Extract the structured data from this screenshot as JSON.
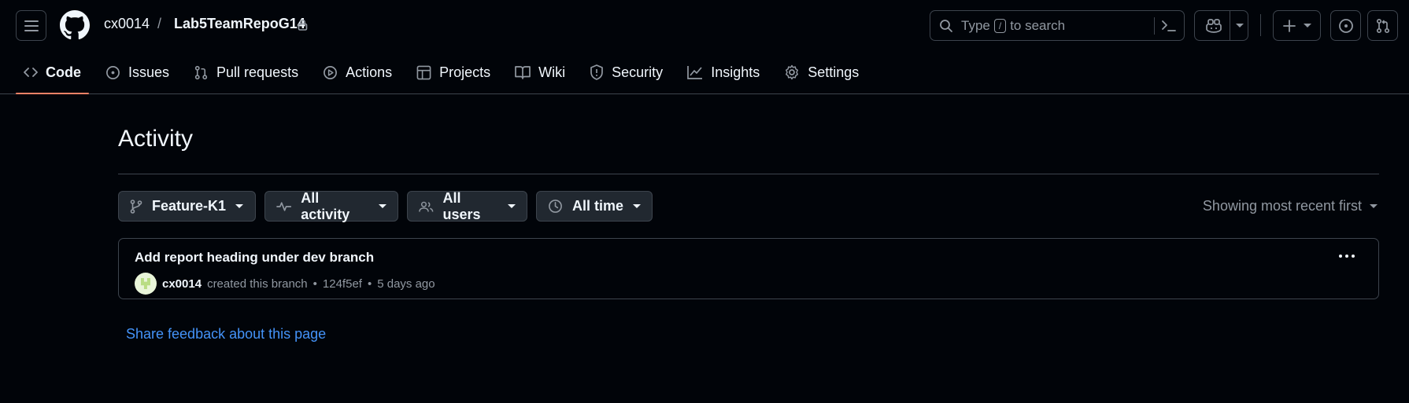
{
  "header": {
    "owner": "cx0014",
    "separator": "/",
    "repo": "Lab5TeamRepoG14",
    "search_prefix": "Type",
    "search_key": "/",
    "search_suffix": "to search"
  },
  "tabs": [
    {
      "label": "Code",
      "icon": "code-icon",
      "active": true
    },
    {
      "label": "Issues",
      "icon": "issue-opened-icon"
    },
    {
      "label": "Pull requests",
      "icon": "git-pull-request-icon"
    },
    {
      "label": "Actions",
      "icon": "play-icon"
    },
    {
      "label": "Projects",
      "icon": "table-icon"
    },
    {
      "label": "Wiki",
      "icon": "book-icon"
    },
    {
      "label": "Security",
      "icon": "shield-icon"
    },
    {
      "label": "Insights",
      "icon": "graph-icon"
    },
    {
      "label": "Settings",
      "icon": "gear-icon"
    }
  ],
  "page": {
    "title": "Activity",
    "filters": {
      "branch": "Feature-K1",
      "activity": "All activity",
      "users": "All users",
      "time": "All time"
    },
    "sort": "Showing most recent first",
    "entry": {
      "title": "Add report heading under dev branch",
      "author": "cx0014",
      "action": "created this branch",
      "dot1": "•",
      "sha": "124f5ef",
      "dot2": "•",
      "when": "5 days ago"
    },
    "feedback": "Share feedback about this page"
  },
  "colors": {
    "background": "#010409",
    "border": "#3d444d",
    "accent_underline": "#f78166",
    "link": "#4493f8"
  }
}
